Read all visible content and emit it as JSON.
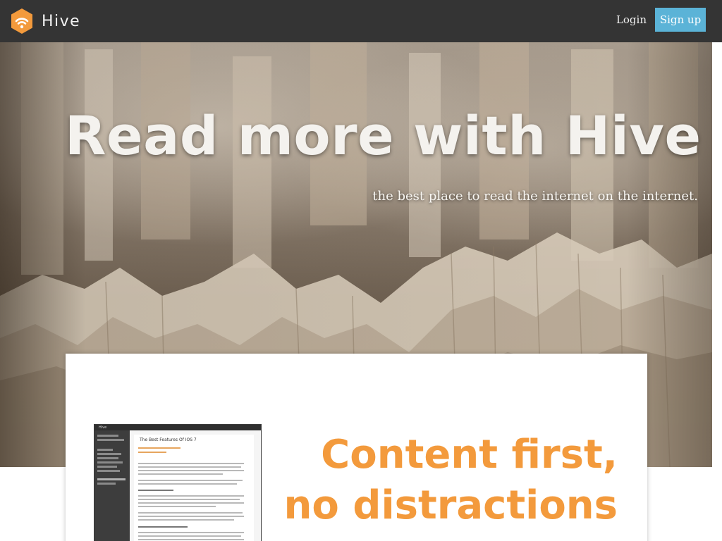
{
  "header": {
    "brand_name": "Hive",
    "logo_icon": "hive-wifi-hexagon-icon",
    "login_label": "Login",
    "signup_label": "Sign up",
    "colors": {
      "bar": "#343434",
      "signup": "#5bb3d7",
      "logo": "#f39a3c"
    }
  },
  "hero": {
    "title": "Read more with Hive",
    "subtitle": "the best place to read the internet on the internet."
  },
  "feature": {
    "heading_line1": "Content first,",
    "heading_line2": "no distractions",
    "accent_color": "#f39a3c",
    "preview": {
      "app_name": "Hive",
      "article_title": "The Best Features Of IOS 7"
    }
  }
}
